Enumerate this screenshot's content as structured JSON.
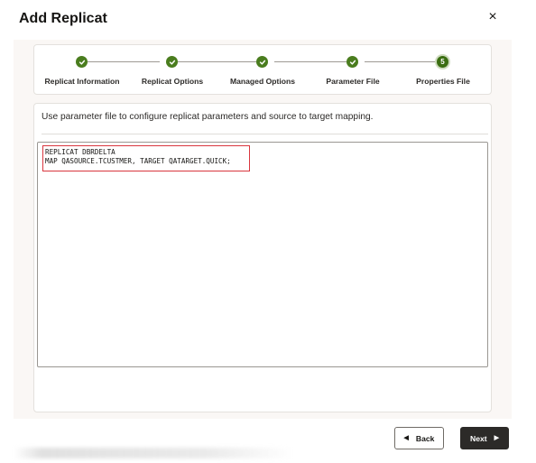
{
  "dialog": {
    "title": "Add Replicat",
    "close_icon": "×"
  },
  "steps": [
    {
      "label": "Replicat Information",
      "state": "complete",
      "icon": "check-icon"
    },
    {
      "label": "Replicat Options",
      "state": "complete",
      "icon": "check-icon"
    },
    {
      "label": "Managed Options",
      "state": "complete",
      "icon": "check-icon"
    },
    {
      "label": "Parameter File",
      "state": "complete",
      "icon": "check-icon"
    },
    {
      "label": "Properties File",
      "state": "current",
      "number": "5"
    }
  ],
  "content": {
    "instruction": "Use parameter file to configure replicat parameters and source to target mapping.",
    "editor_lines": [
      "REPLICAT DBRDELTA",
      "MAP QASOURCE.TCUSTMER, TARGET QATARGET.QUICK;"
    ]
  },
  "footer": {
    "back_label": "Back",
    "next_label": "Next"
  },
  "colors": {
    "step_complete": "#4a7d1e",
    "highlight_border": "#d9363e",
    "primary_button": "#2c2a28"
  }
}
